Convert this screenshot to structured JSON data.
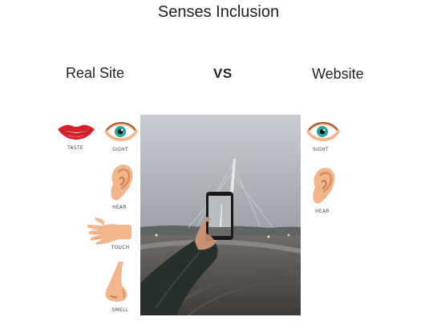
{
  "title": "Senses Inclusion",
  "headers": {
    "left": "Real Site",
    "middle": "VS",
    "right": "Website"
  },
  "real_site_senses": [
    {
      "label": "TASTE",
      "icon": "lips-icon"
    },
    {
      "label": "SIGHT",
      "icon": "eye-icon"
    },
    {
      "label": "HEAR",
      "icon": "ear-icon"
    },
    {
      "label": "TOUCH",
      "icon": "hand-icon"
    },
    {
      "label": "SMELL",
      "icon": "nose-icon"
    }
  ],
  "website_senses": [
    {
      "label": "SIGHT",
      "icon": "eye-icon"
    },
    {
      "label": "HEAR",
      "icon": "ear-icon"
    }
  ],
  "colors": {
    "skin": "#f2b58c",
    "skin_dark": "#d98e62",
    "lips": "#d8202a",
    "iris": "#2aa69b"
  }
}
